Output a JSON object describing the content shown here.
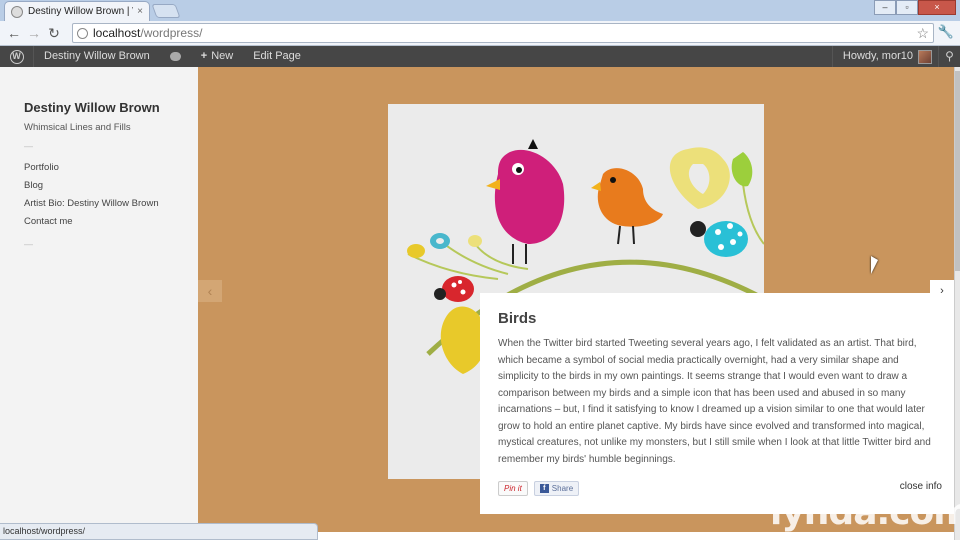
{
  "browser": {
    "tab_title": "Destiny Willow Brown | Wh",
    "tab_close": "×",
    "url_host": "localhost",
    "url_path": "/wordpress/",
    "status_url": "localhost/wordpress/"
  },
  "adminbar": {
    "site_name": "Destiny Willow Brown",
    "new_label": "New",
    "edit_label": "Edit Page",
    "howdy": "Howdy, mor10"
  },
  "site": {
    "title": "Destiny Willow Brown",
    "description": "Whimsical Lines and Fills",
    "divider": "—",
    "menu": [
      "Portfolio",
      "Blog",
      "Artist Bio: Destiny Willow Brown",
      "Contact me"
    ]
  },
  "artwork": {
    "title": "Birds",
    "description": "When the Twitter bird started Tweeting several years ago, I felt validated as an artist. That bird, which became a symbol of social media practically overnight, had a very similar shape and simplicity to the birds in my own paintings. It seems strange that I would even want to draw a comparison between my birds and a simple icon that has been used and abused in so many incarnations – but, I find it satisfying to know I dreamed up a vision similar to one that would later grow to hold an entire planet captive. My birds have since evolved and transformed into magical, mystical creatures, not unlike my monsters, but I still smile when I look at that little Twitter bird and remember my birds' humble beginnings.",
    "pin_label": "Pin it",
    "share_label": "Share",
    "close_label": "close info"
  },
  "nav": {
    "prev": "‹",
    "next": "›"
  },
  "watermark": "lynda.com",
  "colors": {
    "background": "#c9955d",
    "adminbar": "#464646",
    "sidebar": "#f3f3f3"
  }
}
